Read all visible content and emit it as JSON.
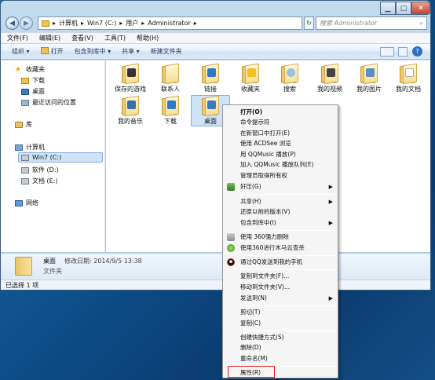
{
  "window": {
    "breadcrumb": [
      "计算机",
      "Win7 (C:)",
      "用户",
      "Administrator"
    ],
    "search_placeholder": "搜索 Administrator"
  },
  "menubar": [
    "文件(F)",
    "编辑(E)",
    "查看(V)",
    "工具(T)",
    "帮助(H)"
  ],
  "toolbar": {
    "organize": "组织 ▾",
    "open": "打开",
    "include": "包含到库中 ▾",
    "share": "共享 ▾",
    "new_folder": "新建文件夹"
  },
  "nav": {
    "favorites": "收藏夹",
    "downloads": "下载",
    "desktop": "桌面",
    "recent": "最近访问的位置",
    "library": "库",
    "computer": "计算机",
    "drive_c": "Win7 (C:)",
    "drive_d": "软件 (D:)",
    "drive_e": "文档 (E:)",
    "network": "网络"
  },
  "folders": [
    {
      "label": "保存的游戏"
    },
    {
      "label": "联系人"
    },
    {
      "label": "链接"
    },
    {
      "label": "收藏夹"
    },
    {
      "label": "搜索"
    },
    {
      "label": "我的视频"
    },
    {
      "label": "我的图片"
    },
    {
      "label": "我的文档"
    },
    {
      "label": "我的音乐"
    },
    {
      "label": "下载"
    },
    {
      "label": "桌面"
    }
  ],
  "details": {
    "name": "桌面",
    "modified": "修改日期: 2014/9/5 13:38",
    "type": "文件夹"
  },
  "status": "已选择 1 项",
  "context_menu": {
    "open": "打开(O)",
    "cmd": "命令提示符",
    "new_window": "在新窗口中打开(E)",
    "acdsee": "使用 ACDSee 浏览",
    "qqmusic_play": "用 QQMusic 播放(P)",
    "qqmusic_queue": "加入 QQMusic 播放队列(E)",
    "admin": "管理员取得所有权",
    "haozip": "好压(G)",
    "share": "共享(H)",
    "restore": "还原以前的版本(V)",
    "include_lib": "包含到库中(I)",
    "del360": "使用 360强力删除",
    "scan360": "使用360进行木马云查杀",
    "send_qq": "通过QQ发送到我的手机",
    "copy_to": "复制到文件夹(F)...",
    "move_to": "移动到文件夹(V)...",
    "send_to": "发送到(N)",
    "cut": "剪切(T)",
    "copy": "复制(C)",
    "shortcut": "创建快捷方式(S)",
    "delete": "删除(D)",
    "rename": "重命名(M)",
    "properties": "属性(R)"
  },
  "colors": {
    "highlight_box": "#e02020",
    "selection": "#cfe3f8"
  }
}
